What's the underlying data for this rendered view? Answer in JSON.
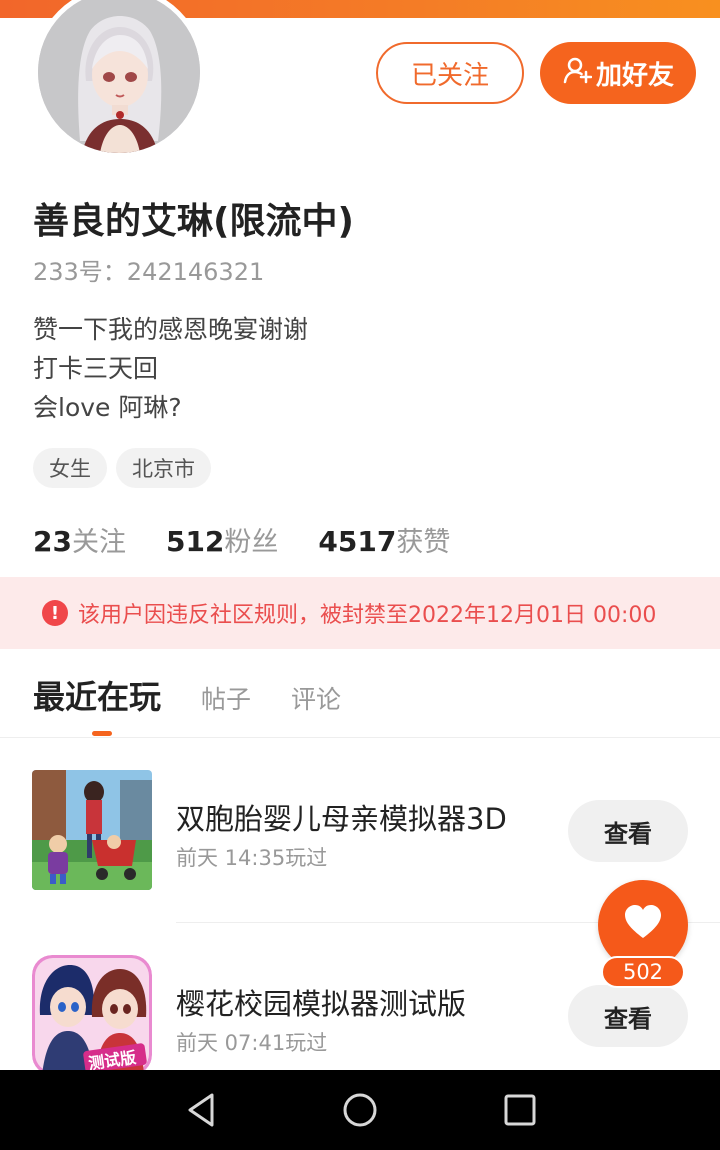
{
  "colors": {
    "accent": "#f5641e",
    "ban_text": "#ea4e4e",
    "ban_bg": "#fdeaea"
  },
  "header": {
    "followed_label": "已关注",
    "add_friend_label": "加好友",
    "add_friend_icon": "add-user-icon"
  },
  "profile": {
    "name": "善良的艾琳(限流中)",
    "id_line": "233号：242146321",
    "bio": [
      "赞一下我的感恩晚宴谢谢",
      "打卡三天回",
      "会love 阿琳?"
    ],
    "tags": [
      "女生",
      "北京市"
    ]
  },
  "stats": [
    {
      "num": "23",
      "label": "关注"
    },
    {
      "num": "512",
      "label": "粉丝"
    },
    {
      "num": "4517",
      "label": "获赞"
    }
  ],
  "ban_notice": {
    "icon": "exclamation-icon",
    "text": "该用户因违反社区规则，被封禁至2022年12月01日 00:00"
  },
  "tabs": [
    "最近在玩",
    "帖子",
    "评论"
  ],
  "games": [
    {
      "title": "双胞胎婴儿母亲模拟器3D",
      "time": "前天 14:35玩过",
      "button": "查看"
    },
    {
      "title": "樱花校园模拟器测试版",
      "time": "前天 07:41玩过",
      "button": "查看",
      "thumb_badge": "测试版"
    }
  ],
  "like": {
    "icon": "heart-icon",
    "count": "502"
  },
  "navbar": {
    "icons": [
      "back-icon",
      "home-icon",
      "recents-icon"
    ]
  }
}
